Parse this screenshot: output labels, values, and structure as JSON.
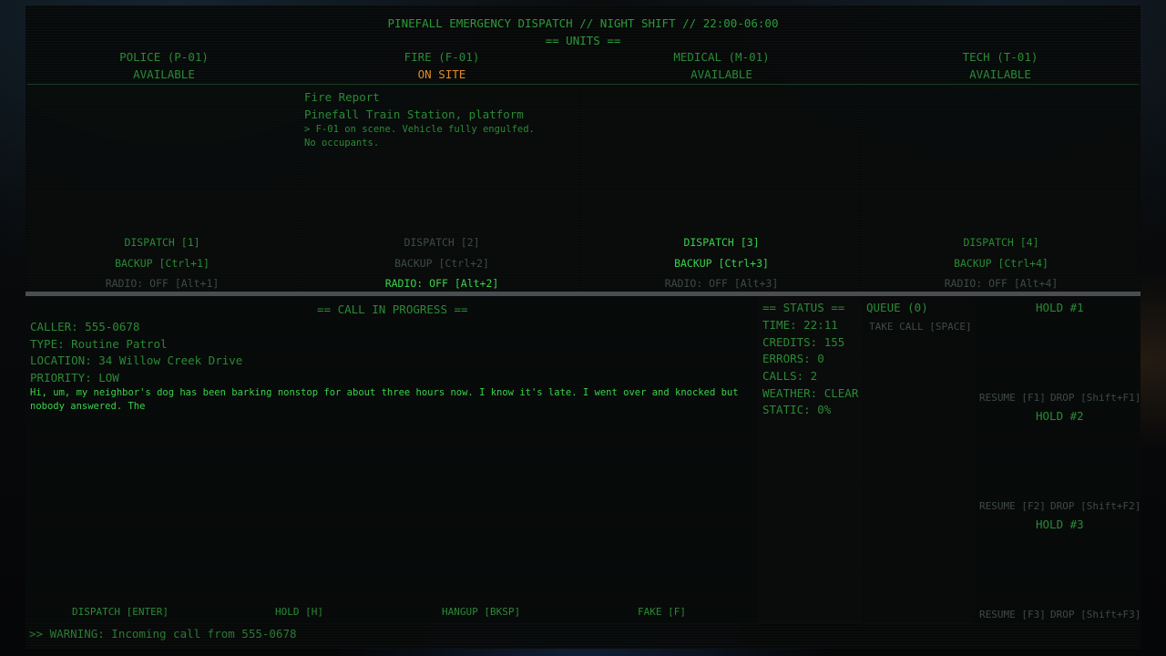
{
  "header": {
    "title": "PINEFALL EMERGENCY DISPATCH // NIGHT SHIFT // 22:00-06:00",
    "units_title": "== UNITS =="
  },
  "units": [
    {
      "name": "POLICE (P-01)",
      "status": "AVAILABLE",
      "dispatch": "DISPATCH [1]",
      "backup": "BACKUP [Ctrl+1]",
      "radio": "RADIO: OFF [Alt+1]"
    },
    {
      "name": "FIRE (F-01)",
      "status": "ON SITE",
      "dispatch": "DISPATCH [2]",
      "backup": "BACKUP [Ctrl+2]",
      "radio": "RADIO: OFF [Alt+2]"
    },
    {
      "name": "MEDICAL (M-01)",
      "status": "AVAILABLE",
      "dispatch": "DISPATCH [3]",
      "backup": "BACKUP [Ctrl+3]",
      "radio": "RADIO: OFF [Alt+3]"
    },
    {
      "name": "TECH (T-01)",
      "status": "AVAILABLE",
      "dispatch": "DISPATCH [4]",
      "backup": "BACKUP [Ctrl+4]",
      "radio": "RADIO: OFF [Alt+4]"
    }
  ],
  "fire_report": {
    "title": "Fire Report",
    "location": "Pinefall Train Station, platform",
    "note": "> F-01 on scene. Vehicle fully engulfed. No occupants."
  },
  "call": {
    "heading": "== CALL IN PROGRESS ==",
    "caller": "CALLER: 555-0678",
    "type": "TYPE: Routine Patrol",
    "location": "LOCATION: 34 Willow Creek Drive",
    "priority": "PRIORITY: LOW",
    "transcript": "Hi, um, my neighbor's dog has been barking nonstop for about three hours now. I know it's late. I went over and knocked but nobody answered. The",
    "actions": {
      "dispatch": "DISPATCH [ENTER]",
      "hold": "HOLD [H]",
      "hangup": "HANGUP [BKSP]",
      "fake": "FAKE [F]"
    }
  },
  "status": {
    "heading": "== STATUS ==",
    "time": "TIME: 22:11",
    "credits": "CREDITS: 155",
    "errors": "ERRORS: 0",
    "calls": "CALLS: 2",
    "weather": "WEATHER: CLEAR",
    "static": "STATIC: 0%"
  },
  "queue": {
    "heading": "QUEUE (0)",
    "take_call": "TAKE CALL [SPACE]"
  },
  "holds": [
    {
      "title": "HOLD #1",
      "resume": "RESUME [F1]",
      "drop": "DROP [Shift+F1]"
    },
    {
      "title": "HOLD #2",
      "resume": "RESUME [F2]",
      "drop": "DROP [Shift+F2]"
    },
    {
      "title": "HOLD #3",
      "resume": "RESUME [F3]",
      "drop": "DROP [Shift+F3]"
    }
  ],
  "warning": ">> WARNING: Incoming call from 555-0678",
  "colors": {
    "green": "#3ad24a",
    "amber": "#e08a2a",
    "dim": "#3f4a44"
  }
}
